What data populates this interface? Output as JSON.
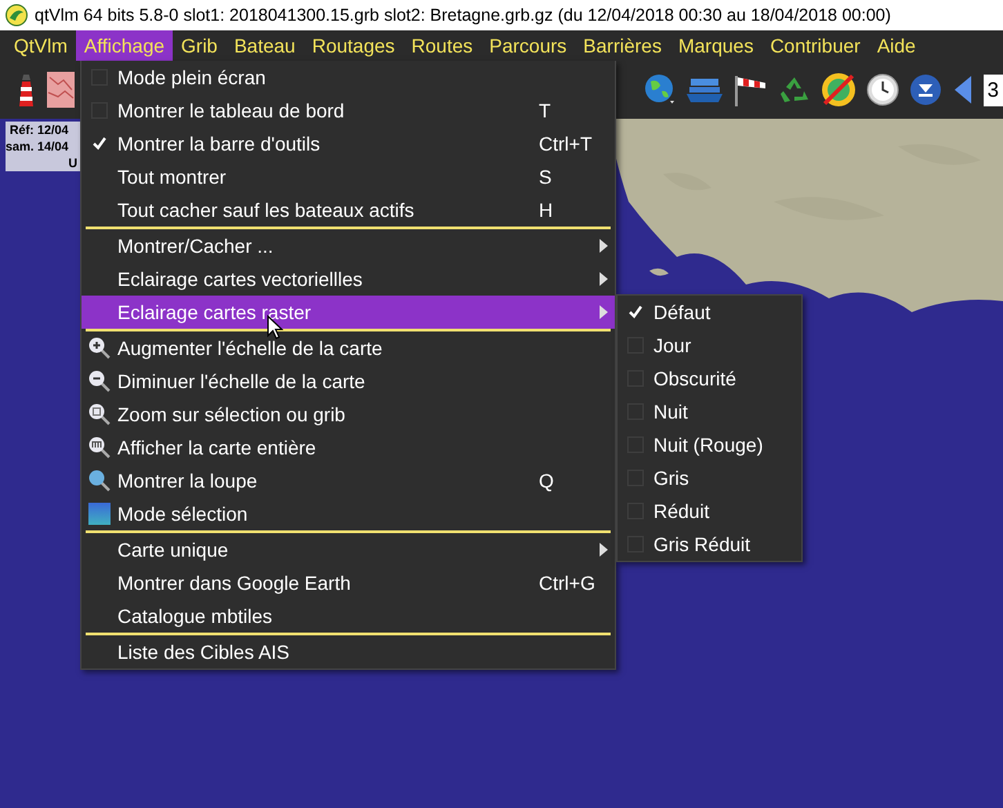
{
  "window": {
    "title": "qtVlm 64 bits 5.8-0 slot1: 2018041300.15.grb slot2: Bretagne.grb.gz (du 12/04/2018 00:30 au 18/04/2018 00:00)"
  },
  "menubar": [
    {
      "label": "QtVlm",
      "selected": false
    },
    {
      "label": "Affichage",
      "selected": true
    },
    {
      "label": "Grib",
      "selected": false
    },
    {
      "label": "Bateau",
      "selected": false
    },
    {
      "label": "Routages",
      "selected": false
    },
    {
      "label": "Routes",
      "selected": false
    },
    {
      "label": "Parcours",
      "selected": false
    },
    {
      "label": "Barrières",
      "selected": false
    },
    {
      "label": "Marques",
      "selected": false
    },
    {
      "label": "Contribuer",
      "selected": false
    },
    {
      "label": "Aide",
      "selected": false
    }
  ],
  "toolbar": {
    "zoom_field": {
      "value": "3"
    }
  },
  "info_box": {
    "lines": [
      "Réf: 12/04",
      "sam. 14/04",
      "U"
    ]
  },
  "menu": {
    "sections": [
      {
        "items": [
          {
            "kind": "check",
            "label": "Mode plein écran",
            "checked": false,
            "submenu": false,
            "selected": false
          },
          {
            "kind": "check",
            "label": "Montrer le tableau de bord",
            "checked": false,
            "shortcut": "T",
            "submenu": false,
            "selected": false
          },
          {
            "kind": "check",
            "label": "Montrer la barre d'outils",
            "checked": true,
            "shortcut": "Ctrl+T",
            "submenu": false,
            "selected": false
          },
          {
            "kind": "plain",
            "label": "Tout montrer",
            "shortcut": "S",
            "submenu": false,
            "selected": false
          },
          {
            "kind": "plain",
            "label": "Tout cacher sauf les bateaux actifs",
            "shortcut": "H",
            "submenu": false,
            "selected": false
          }
        ]
      },
      {
        "items": [
          {
            "kind": "plain",
            "label": "Montrer/Cacher ...",
            "submenu": true,
            "selected": false
          },
          {
            "kind": "plain",
            "label": "Eclairage cartes vectoriellles",
            "submenu": true,
            "selected": false
          },
          {
            "kind": "plain",
            "label": "Eclairage cartes raster",
            "submenu": true,
            "selected": true
          }
        ]
      },
      {
        "items": [
          {
            "kind": "icon",
            "label": "Augmenter l'échelle de la carte",
            "submenu": false,
            "selected": false
          },
          {
            "kind": "icon",
            "label": "Diminuer l'échelle de la carte",
            "submenu": false,
            "selected": false
          },
          {
            "kind": "icon",
            "label": "Zoom sur sélection ou grib",
            "submenu": false,
            "selected": false
          },
          {
            "kind": "icon",
            "label": "Afficher la carte entière",
            "submenu": false,
            "selected": false
          },
          {
            "kind": "icon",
            "label": "Montrer la loupe",
            "shortcut": "Q",
            "submenu": false,
            "selected": false
          },
          {
            "kind": "icon",
            "label": "Mode sélection",
            "submenu": false,
            "selected": false
          }
        ]
      },
      {
        "items": [
          {
            "kind": "plain",
            "label": "Carte unique",
            "submenu": true,
            "selected": false
          },
          {
            "kind": "plain",
            "label": "Montrer dans Google Earth",
            "shortcut": "Ctrl+G",
            "submenu": false,
            "selected": false
          },
          {
            "kind": "plain",
            "label": "Catalogue mbtiles",
            "submenu": false,
            "selected": false
          }
        ]
      },
      {
        "items": [
          {
            "kind": "plain",
            "label": "Liste des Cibles AIS",
            "submenu": false,
            "selected": false
          }
        ]
      }
    ]
  },
  "submenu": {
    "items": [
      {
        "label": "Défaut",
        "checked": true
      },
      {
        "label": "Jour",
        "checked": false
      },
      {
        "label": "Obscurité",
        "checked": false
      },
      {
        "label": "Nuit",
        "checked": false
      },
      {
        "label": "Nuit (Rouge)",
        "checked": false
      },
      {
        "label": "Gris",
        "checked": false
      },
      {
        "label": "Réduit",
        "checked": false
      },
      {
        "label": "Gris Réduit",
        "checked": false
      }
    ]
  }
}
